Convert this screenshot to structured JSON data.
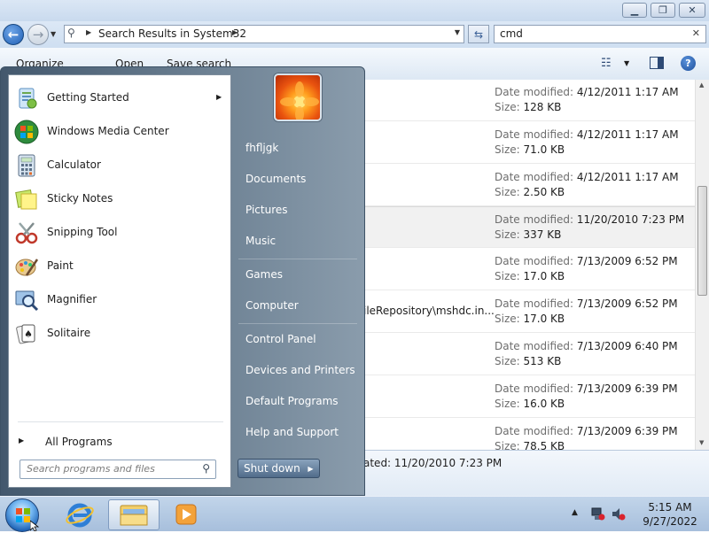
{
  "explorer": {
    "address": "Search Results in System32",
    "search_value": "cmd",
    "toolbar": {
      "organize": "Organize",
      "open": "Open",
      "save_search": "Save search"
    },
    "rows": [
      {
        "label_modified": "Date modified:",
        "date": "4/12/2011 1:17 AM",
        "label_size": "Size:",
        "size": "128 KB",
        "path": ""
      },
      {
        "label_modified": "Date modified:",
        "date": "4/12/2011 1:17 AM",
        "label_size": "Size:",
        "size": "71.0 KB",
        "path": ""
      },
      {
        "label_modified": "Date modified:",
        "date": "4/12/2011 1:17 AM",
        "label_size": "Size:",
        "size": "2.50 KB",
        "path": ""
      },
      {
        "label_modified": "Date modified:",
        "date": "11/20/2010 7:23 PM",
        "label_size": "Size:",
        "size": "337 KB",
        "path": ""
      },
      {
        "label_modified": "Date modified:",
        "date": "7/13/2009 6:52 PM",
        "label_size": "Size:",
        "size": "17.0 KB",
        "path": ""
      },
      {
        "label_modified": "Date modified:",
        "date": "7/13/2009 6:52 PM",
        "label_size": "Size:",
        "size": "17.0 KB",
        "path": "ileRepository\\mshdc.in..."
      },
      {
        "label_modified": "Date modified:",
        "date": "7/13/2009 6:40 PM",
        "label_size": "Size:",
        "size": "513 KB",
        "path": ""
      },
      {
        "label_modified": "Date modified:",
        "date": "7/13/2009 6:39 PM",
        "label_size": "Size:",
        "size": "16.0 KB",
        "path": ""
      },
      {
        "label_modified": "Date modified:",
        "date": "7/13/2009 6:39 PM",
        "label_size": "Size:",
        "size": "78.5 KB",
        "path": ""
      }
    ],
    "details_text": "ated: 11/20/2010 7:23 PM"
  },
  "start_menu": {
    "programs": [
      {
        "label": "Getting Started",
        "icon": "getting-started-icon"
      },
      {
        "label": "Windows Media Center",
        "icon": "media-center-icon"
      },
      {
        "label": "Calculator",
        "icon": "calculator-icon"
      },
      {
        "label": "Sticky Notes",
        "icon": "sticky-notes-icon"
      },
      {
        "label": "Snipping Tool",
        "icon": "snipping-tool-icon"
      },
      {
        "label": "Paint",
        "icon": "paint-icon"
      },
      {
        "label": "Magnifier",
        "icon": "magnifier-icon"
      },
      {
        "label": "Solitaire",
        "icon": "solitaire-icon"
      }
    ],
    "all_programs": "All Programs",
    "search_placeholder": "Search programs and files",
    "right_items": [
      "fhfljgk",
      "Documents",
      "Pictures",
      "Music",
      "Games",
      "Computer",
      "Control Panel",
      "Devices and Printers",
      "Default Programs",
      "Help and Support"
    ],
    "shutdown": "Shut down"
  },
  "taskbar": {
    "time": "5:15 AM",
    "date": "9/27/2022"
  },
  "colors": {
    "start_menu_right": "#43586d",
    "selection": "#f1f1f1",
    "taskbar": "#b4c9e2"
  }
}
